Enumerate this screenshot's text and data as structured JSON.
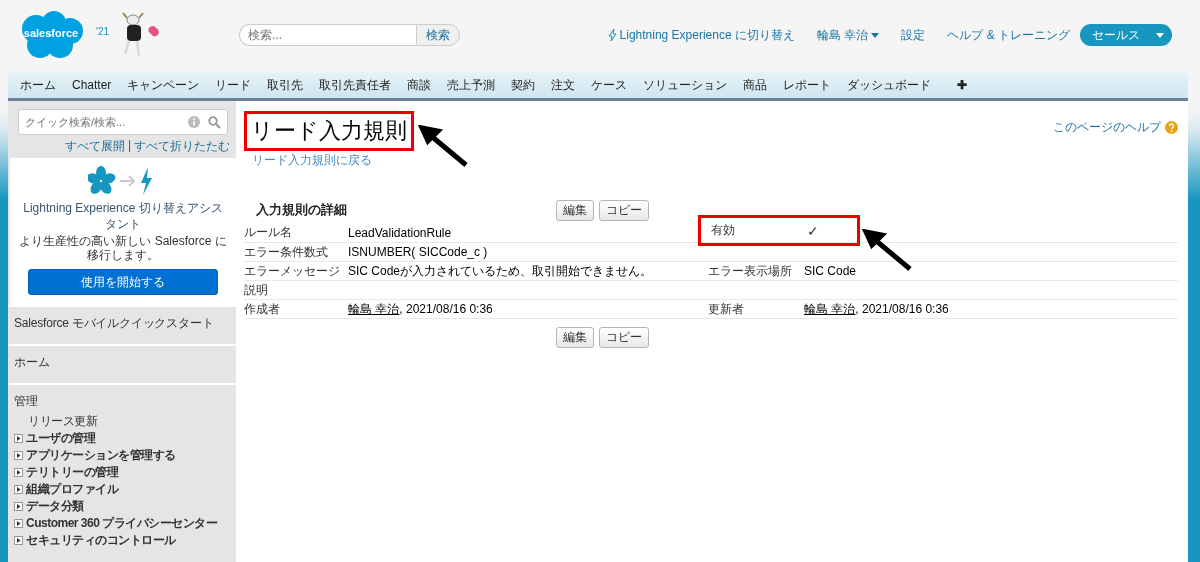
{
  "header": {
    "logo_text": "salesforce",
    "release": "'21",
    "search": {
      "placeholder": "検索...",
      "button": "検索"
    },
    "links": [
      {
        "kind": "lightning",
        "label": "Lightning Experience に切り替え"
      },
      {
        "kind": "user",
        "label": "輪島 幸治"
      },
      {
        "kind": "plain",
        "label": "設定"
      },
      {
        "kind": "plain",
        "label": "ヘルプ & トレーニング"
      }
    ],
    "app_menu": "セールス"
  },
  "tabs": [
    {
      "kind": "tab",
      "label": "ホーム"
    },
    {
      "kind": "tab",
      "label": "Chatter"
    },
    {
      "kind": "tab",
      "label": "キャンペーン"
    },
    {
      "kind": "tab",
      "label": "リード"
    },
    {
      "kind": "tab",
      "label": "取引先"
    },
    {
      "kind": "tab",
      "label": "取引先責任者"
    },
    {
      "kind": "tab",
      "label": "商談"
    },
    {
      "kind": "tab",
      "label": "売上予測"
    },
    {
      "kind": "tab",
      "label": "契約"
    },
    {
      "kind": "tab",
      "label": "注文"
    },
    {
      "kind": "tab",
      "label": "ケース"
    },
    {
      "kind": "tab",
      "label": "ソリューション"
    },
    {
      "kind": "tab",
      "label": "商品"
    },
    {
      "kind": "tab",
      "label": "レポート"
    },
    {
      "kind": "tab",
      "label": "ダッシュボード"
    },
    {
      "kind": "add",
      "label": "✚"
    }
  ],
  "sidebar": {
    "quick_search": {
      "placeholder": "クイック検索/検索..."
    },
    "expand_all": "すべて展開",
    "separator": "|",
    "collapse_all": "すべて折りたたむ",
    "card": {
      "title": "Lightning Experience 切り替えアシスタント",
      "description": "より生産性の高い新しい Salesforce に移行します。",
      "button": "使用を開始する"
    },
    "sections": [
      {
        "title": "Salesforce モバイルクイックスタート"
      },
      {
        "title": "ホーム"
      },
      {
        "title": "管理",
        "items": [
          {
            "label": "リリース更新",
            "expandable": false
          },
          {
            "label": "ユーザの管理",
            "expandable": true
          },
          {
            "label": "アプリケーションを管理する",
            "expandable": true
          },
          {
            "label": "テリトリーの管理",
            "expandable": true
          },
          {
            "label": "組織プロファイル",
            "expandable": true
          },
          {
            "label": "データ分類",
            "expandable": true
          },
          {
            "label": "Customer 360 プライバシーセンター",
            "expandable": true
          },
          {
            "label": "セキュリティのコントロール",
            "expandable": true
          }
        ]
      }
    ]
  },
  "main": {
    "title": "リード入力規則",
    "title_highlighted": true,
    "back_link": "リード入力規則に戻る",
    "help_link": "このページのヘルプ",
    "detail": {
      "title": "入力規則の詳細",
      "buttons": [
        "編集",
        "コピー"
      ],
      "rows": [
        [
          {
            "label": "ルール名",
            "kind": "text",
            "value": "LeadValidationRule"
          },
          {
            "label": "有効",
            "kind": "checkbox",
            "checked": true,
            "mark": "✓",
            "highlighted": true
          }
        ],
        [
          {
            "label": "エラー条件数式",
            "kind": "text",
            "value": "ISNUMBER( SICCode_c )"
          }
        ],
        [
          {
            "label": "エラーメッセージ",
            "kind": "text",
            "value": "SIC Codeが入力されているため、取引開始できません。"
          },
          {
            "label": "エラー表示場所",
            "kind": "text",
            "value": "SIC Code"
          }
        ],
        [
          {
            "label": "説明",
            "kind": "text"
          }
        ],
        [
          {
            "label": "作成者",
            "kind": "user",
            "user": "輪島 幸治",
            "date": ", 2021/08/16 0:36"
          },
          {
            "label": "更新者",
            "kind": "user",
            "user": "輪島 幸治",
            "date": ", 2021/08/16 0:36"
          }
        ]
      ],
      "bottom_buttons": [
        "編集",
        "コピー"
      ]
    }
  }
}
